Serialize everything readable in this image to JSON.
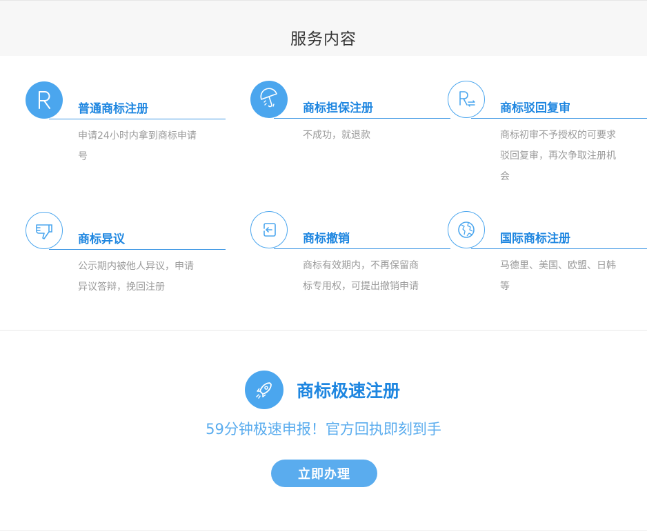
{
  "header": {
    "title": "服务内容"
  },
  "services": [
    {
      "title": "普通商标注册",
      "desc": "申请24小时内拿到商标申请号",
      "icon": "registered-r-icon"
    },
    {
      "title": "商标担保注册",
      "desc": "不成功，就退款",
      "icon": "umbrella-icon"
    },
    {
      "title": "商标驳回复审",
      "desc": "商标初审不予授权的可要求驳回复审，再次争取注册机会",
      "icon": "review-r-icon"
    },
    {
      "title": "商标异议",
      "desc": "公示期内被他人异议，申请异议答辩，挽回注册",
      "icon": "thumbs-down-icon"
    },
    {
      "title": "商标撤销",
      "desc": "商标有效期内，不再保留商标专用权，可提出撤销申请",
      "icon": "exit-icon"
    },
    {
      "title": "国际商标注册",
      "desc": "马德里、美国、欧盟、日韩等",
      "icon": "globe-icon"
    }
  ],
  "promo": {
    "title": "商标极速注册",
    "subtitle": "59分钟极速申报！官方回执即刻到手",
    "button_label": "立即办理",
    "icon": "rocket-icon"
  },
  "colors": {
    "accent": "#1e86e0",
    "icon_fill": "#4ba6ee",
    "header_bg": "#f7f7f7",
    "desc": "#9a9a9a"
  }
}
